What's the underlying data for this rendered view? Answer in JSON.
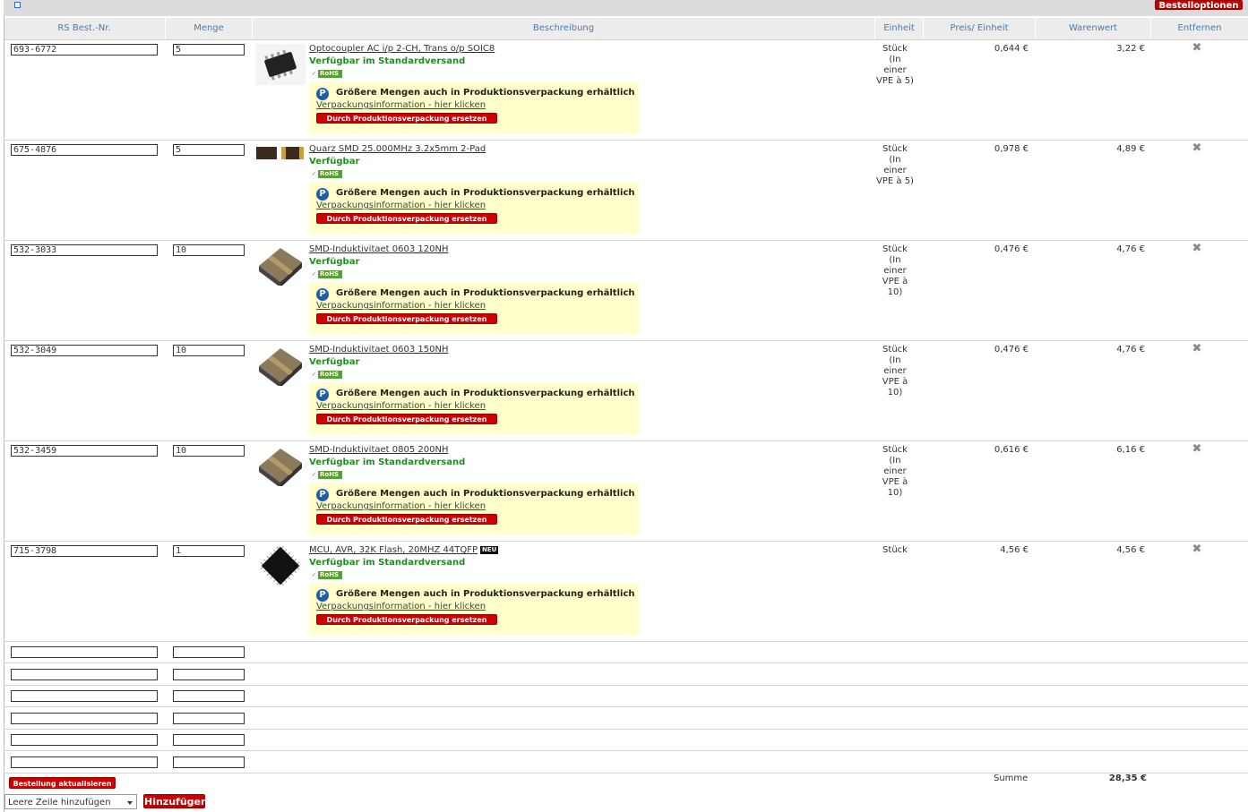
{
  "toolbar": {
    "order_options_label": "Bestelloptionen"
  },
  "columns": {
    "rs_nr": "RS Best.-Nr.",
    "menge": "Menge",
    "beschreibung": "Beschreibung",
    "einheit": "Einheit",
    "preis": "Preis/ Einheit",
    "warenwert": "Warenwert",
    "entfernen": "Entfernen"
  },
  "promo": {
    "text": "Größere Mengen auch in Produktionsverpackung erhältlich",
    "link": "Verpackungsinformation - hier klicken",
    "button": "Durch Produktionsverpackung ersetzen",
    "icon_letter": "P"
  },
  "rohs_label": "RoHS",
  "rows": [
    {
      "nr": "693-6772",
      "qty": "5",
      "name": "Optocoupler AC i/p 2-CH, Trans o/p SOIC8",
      "avail": "Verfügbar im Standardversand",
      "unit": "Stück\n(In\neiner\nVPE à 5)",
      "price": "0,644 €",
      "total": "3,22 €",
      "image": "soic8-chip",
      "new_badge": ""
    },
    {
      "nr": "675-4876",
      "qty": "5",
      "name": "Quarz SMD 25.000MHz 3.2x5mm 2-Pad",
      "avail": "Verfügbar",
      "unit": "Stück\n(In\neiner\nVPE à 5)",
      "price": "0,978 €",
      "total": "4,89 €",
      "image": "crystal-smd",
      "new_badge": ""
    },
    {
      "nr": "532-3033",
      "qty": "10",
      "name": "SMD-Induktivitaet 0603 120NH",
      "avail": "Verfügbar",
      "unit": "Stück\n(In\neiner\nVPE à\n10)",
      "price": "0,476 €",
      "total": "4,76 €",
      "image": "smd-inductor",
      "new_badge": ""
    },
    {
      "nr": "532-3049",
      "qty": "10",
      "name": "SMD-Induktivitaet 0603 150NH",
      "avail": "Verfügbar",
      "unit": "Stück\n(In\neiner\nVPE à\n10)",
      "price": "0,476 €",
      "total": "4,76 €",
      "image": "smd-inductor",
      "new_badge": ""
    },
    {
      "nr": "532-3459",
      "qty": "10",
      "name": "SMD-Induktivitaet 0805 200NH",
      "avail": "Verfügbar im Standardversand",
      "unit": "Stück\n(In\neiner\nVPE à\n10)",
      "price": "0,616 €",
      "total": "6,16 €",
      "image": "smd-inductor",
      "new_badge": ""
    },
    {
      "nr": "715-3798",
      "qty": "1",
      "name": "MCU, AVR, 32K Flash, 20MHZ 44TQFP",
      "avail": "Verfügbar im Standardversand",
      "unit": "Stück",
      "price": "4,56 €",
      "total": "4,56 €",
      "image": "tqfp-chip",
      "new_badge": "NEU"
    }
  ],
  "footer": {
    "update_label": "Bestellung aktualisieren",
    "summe_label": "Summe",
    "summe_value": "28,35 €",
    "select_value": "Leere Zeile hinzufügen",
    "add_label": "Hinzufügen"
  }
}
